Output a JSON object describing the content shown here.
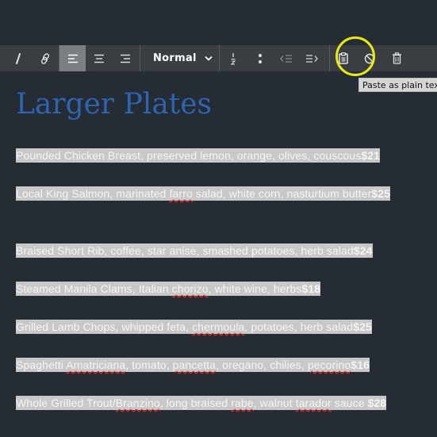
{
  "toolbar": {
    "style_select": {
      "value": "Normal"
    },
    "buttons": [
      {
        "name": "italic",
        "icon": "italic-icon"
      },
      {
        "name": "link",
        "icon": "link-icon"
      },
      {
        "name": "align-left",
        "icon": "align-left-icon",
        "active": true
      },
      {
        "name": "align-center",
        "icon": "align-center-icon"
      },
      {
        "name": "align-right",
        "icon": "align-right-icon"
      },
      {
        "name": "ordered-list",
        "icon": "ordered-list-icon"
      },
      {
        "name": "unordered-list",
        "icon": "unordered-list-icon"
      },
      {
        "name": "outdent",
        "icon": "outdent-icon"
      },
      {
        "name": "indent",
        "icon": "indent-icon"
      },
      {
        "name": "paste-plain-text",
        "icon": "clipboard-icon"
      },
      {
        "name": "clear-formatting",
        "icon": "prohibited-icon"
      },
      {
        "name": "delete",
        "icon": "trash-icon"
      }
    ],
    "tooltip": "Paste as plain text",
    "highlight_color": "#e8e817"
  },
  "editor": {
    "heading": "Larger Plates",
    "heading_color": "#2d64b3",
    "items": [
      {
        "segments": [
          {
            "text": "Pounded Chicken Breast, preserved lemon, orange, olives, couscous"
          },
          {
            "text": "$21",
            "price": true
          }
        ]
      },
      {
        "segments": [
          {
            "text": "Local King Salmon, marinated "
          },
          {
            "text": "farro",
            "misspelled": true
          },
          {
            "text": " salad, white corn, nasturtium butter"
          },
          {
            "text": "$25",
            "price": true
          }
        ]
      },
      {
        "segments": [
          {
            "text": "Braised Short Rib, coffee, star anise, smashed potatoes, herb salad"
          },
          {
            "text": "$24",
            "price": true
          }
        ]
      },
      {
        "segments": [
          {
            "text": "Steamed Manila Clams, Italian "
          },
          {
            "text": "chorizo",
            "misspelled": true
          },
          {
            "text": ", white wine, herbs"
          },
          {
            "text": "$18",
            "price": true
          }
        ]
      },
      {
        "segments": [
          {
            "text": "Grilled Lamb Chops, whipped feta, "
          },
          {
            "text": "chermoula",
            "misspelled": true
          },
          {
            "text": ",  potatoes, herb salad"
          },
          {
            "text": "$25",
            "price": true
          }
        ]
      },
      {
        "segments": [
          {
            "text": "Spaghetti "
          },
          {
            "text": "Amatriciana",
            "misspelled": true
          },
          {
            "text": ", tomato, "
          },
          {
            "text": "pancetta",
            "misspelled": true
          },
          {
            "text": ", oregano, chilies, "
          },
          {
            "text": "pecorino",
            "misspelled": true
          },
          {
            "text": "$16",
            "price": true
          }
        ]
      },
      {
        "segments": [
          {
            "text": "Whole Grilled Trout/"
          },
          {
            "text": "Branzino",
            "misspelled": true
          },
          {
            "text": ", long braised "
          },
          {
            "text": "rabe",
            "misspelled": true
          },
          {
            "text": ", walnut "
          },
          {
            "text": "tarador",
            "misspelled": true
          },
          {
            "text": " sauce "
          },
          {
            "text": "$28",
            "price": true
          }
        ]
      }
    ]
  }
}
